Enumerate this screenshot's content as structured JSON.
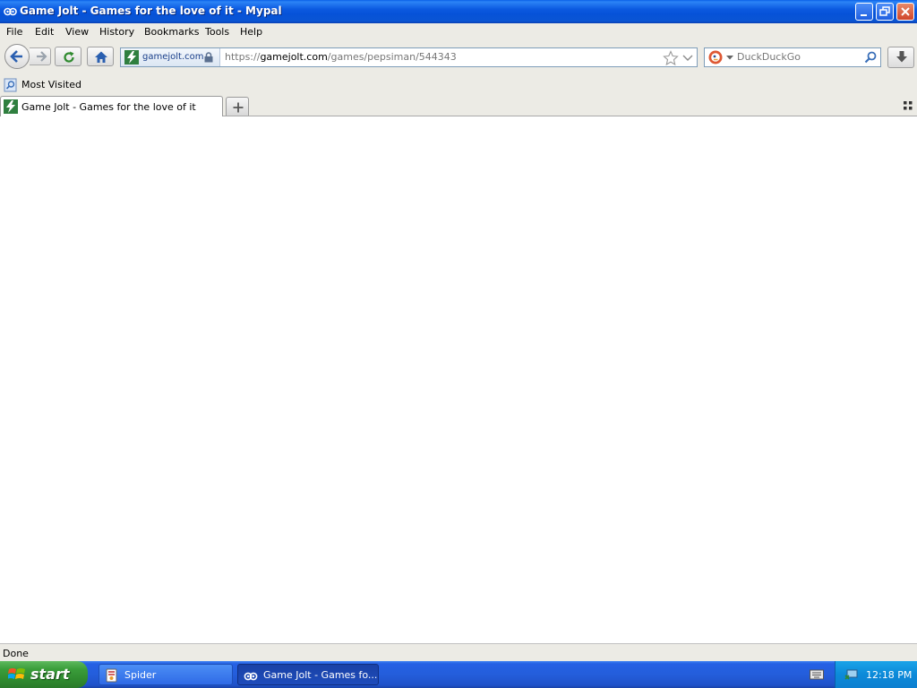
{
  "window": {
    "title": "Game Jolt - Games for the love of it - Mypal"
  },
  "menubar": {
    "items": [
      "File",
      "Edit",
      "View",
      "History",
      "Bookmarks",
      "Tools",
      "Help"
    ]
  },
  "navbar": {
    "site_identity": "gamejolt.com",
    "url_prefix": "https://",
    "url_host": "gamejolt.com",
    "url_path": "/games/pepsiman/544343",
    "search_placeholder": "DuckDuckGo"
  },
  "bookmarks": {
    "items": [
      "Most Visited"
    ]
  },
  "tabs": [
    {
      "label": "Game Jolt - Games for the love of it"
    }
  ],
  "status": {
    "text": "Done"
  },
  "taskbar": {
    "start_label": "start",
    "buttons": [
      {
        "label": "Spider"
      },
      {
        "label": "Game Jolt - Games fo..."
      }
    ],
    "clock": "12:18 PM"
  },
  "colors": {
    "titlebar": "#0a55d4",
    "chrome": "#ecebe5",
    "taskbar": "#245edb",
    "start": "#3a9d3a"
  },
  "icons": [
    "app-icon",
    "minimize-icon",
    "maximize-icon",
    "close-icon",
    "back-arrow-icon",
    "forward-arrow-icon",
    "reload-icon",
    "home-icon",
    "gamejolt-favicon",
    "lock-icon",
    "star-icon",
    "dropdown-icon",
    "duckduckgo-icon",
    "magnifier-icon",
    "download-icon",
    "bookmark-folder-icon",
    "plus-icon",
    "grid-icon",
    "windows-logo-icon",
    "keyboard-icon",
    "network-icon"
  ]
}
